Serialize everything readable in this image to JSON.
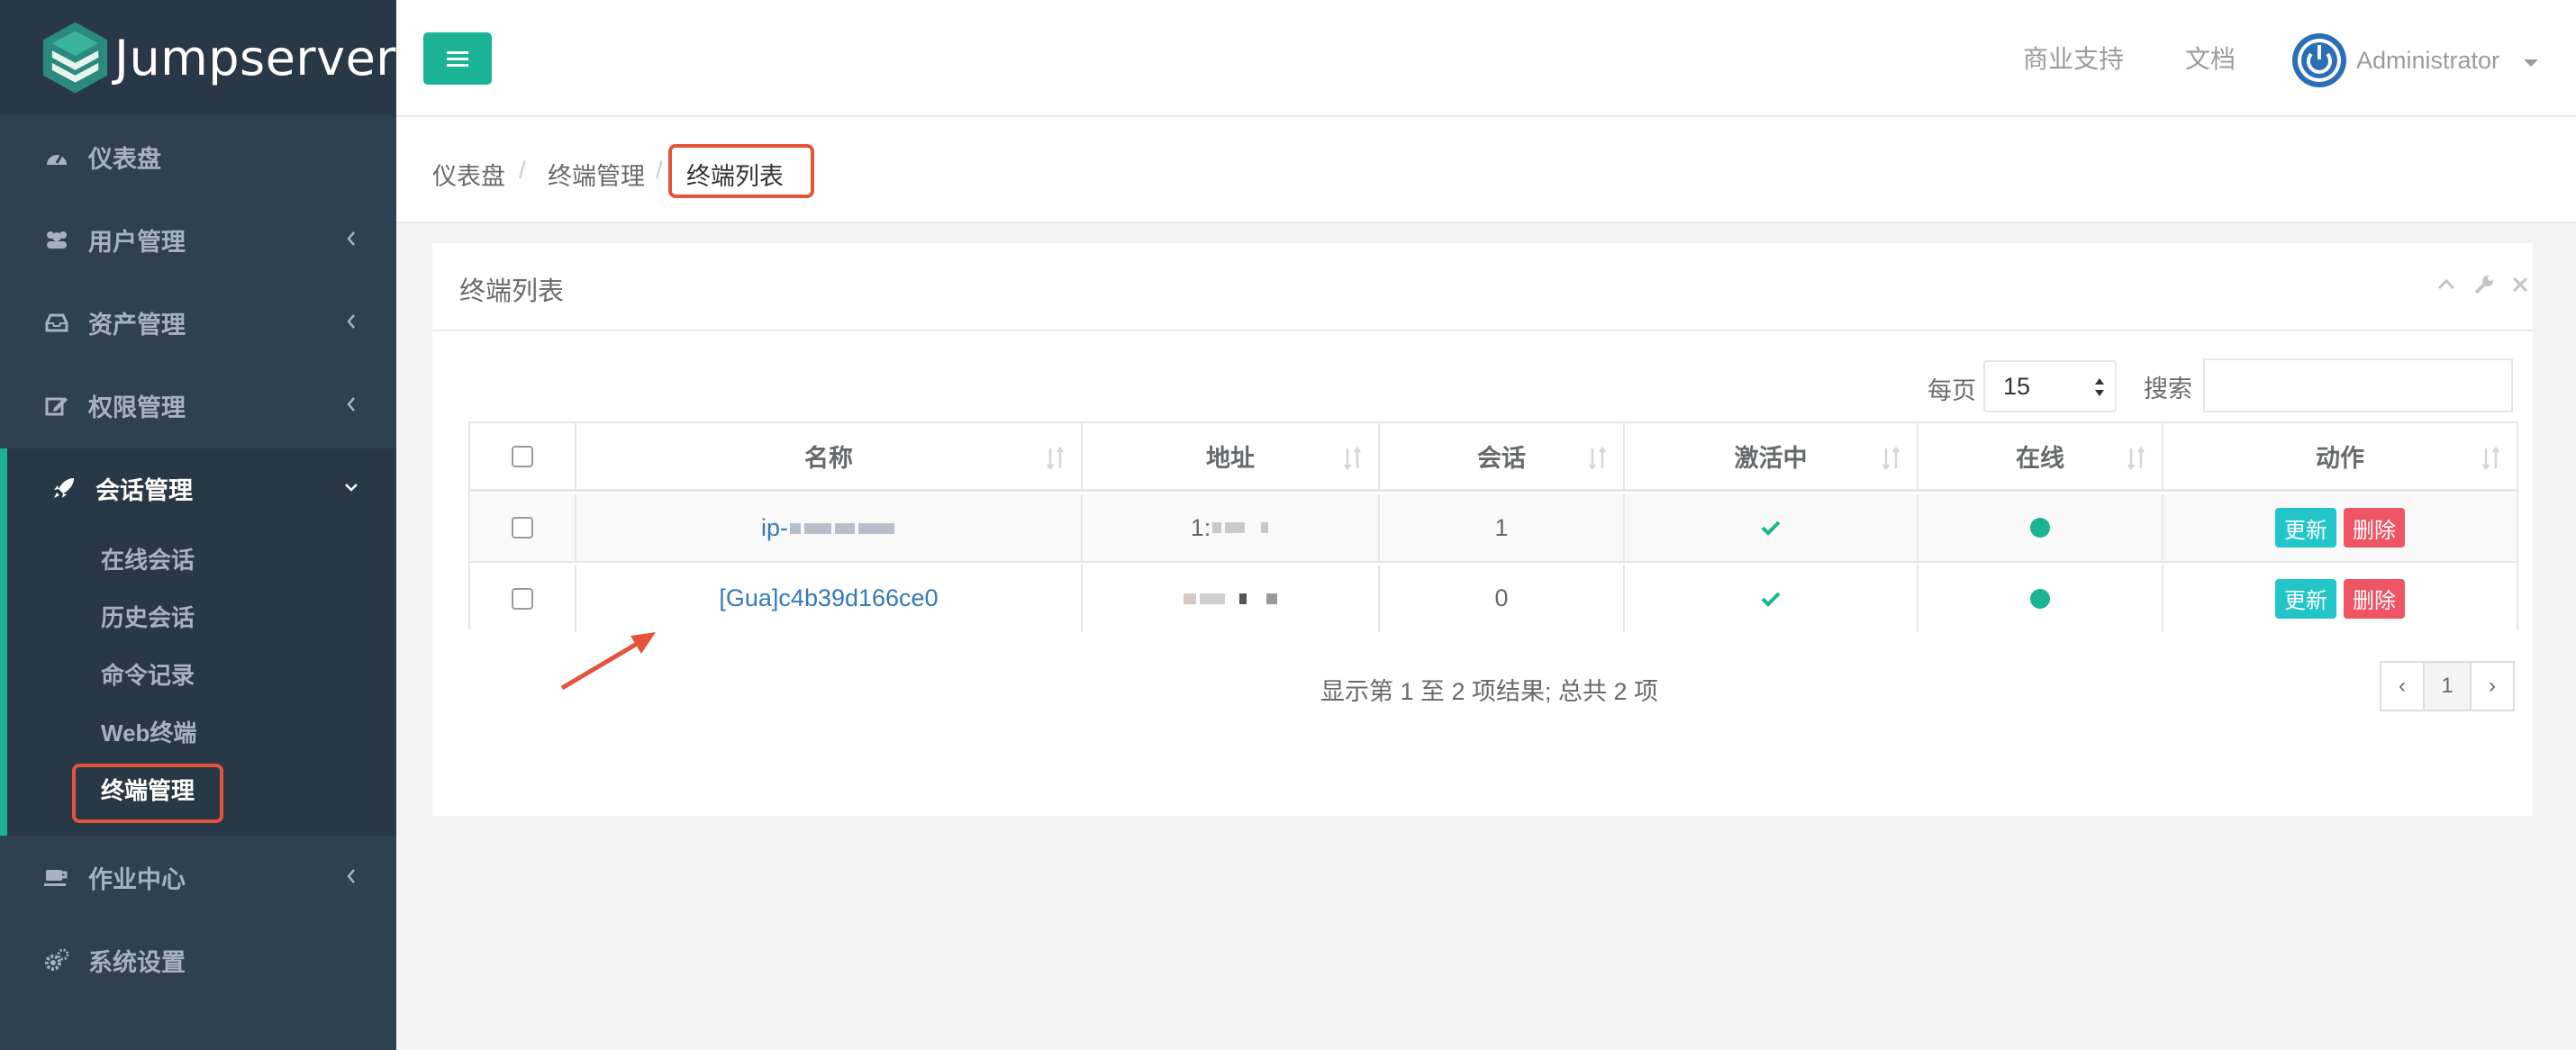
{
  "app": {
    "logo_text": "Jumpserver"
  },
  "colors": {
    "accent": "#1ab394",
    "sidebar": "#2f4050",
    "highlight": "#e5533a",
    "info": "#23c6c8",
    "danger": "#ed5565",
    "link": "#337ab7"
  },
  "sidebar": {
    "items": [
      {
        "label": "仪表盘",
        "icon": "dashboard-icon"
      },
      {
        "label": "用户管理",
        "icon": "users-icon"
      },
      {
        "label": "资产管理",
        "icon": "inbox-icon"
      },
      {
        "label": "权限管理",
        "icon": "edit-icon"
      },
      {
        "label": "会话管理",
        "icon": "rocket-icon"
      },
      {
        "label": "作业中心",
        "icon": "coffee-icon"
      },
      {
        "label": "系统设置",
        "icon": "gears-icon"
      }
    ],
    "sub_items": [
      "在线会话",
      "历史会话",
      "命令记录",
      "Web终端",
      "终端管理"
    ]
  },
  "topbar": {
    "support": "商业支持",
    "docs": "文档",
    "user": "Administrator"
  },
  "breadcrumb": [
    "仪表盘",
    "终端管理",
    "终端列表"
  ],
  "panel": {
    "title": "终端列表",
    "per_page_label": "每页",
    "per_page_value": "15",
    "search_label": "搜索",
    "search_value": ""
  },
  "table": {
    "columns": [
      "名称",
      "地址",
      "会话",
      "激活中",
      "在线",
      "动作"
    ],
    "rows": [
      {
        "name": "ip-",
        "address": "1:",
        "sessions": "1",
        "active": true,
        "online": true,
        "update": "更新",
        "delete": "删除"
      },
      {
        "name": "[Gua]c4b39d166ce0",
        "address": "",
        "sessions": "0",
        "active": true,
        "online": true,
        "update": "更新",
        "delete": "删除"
      }
    ]
  },
  "footer": {
    "summary": "显示第 1 至 2 项结果; 总共 2 项",
    "prev": "‹",
    "page": "1",
    "next": "›"
  }
}
